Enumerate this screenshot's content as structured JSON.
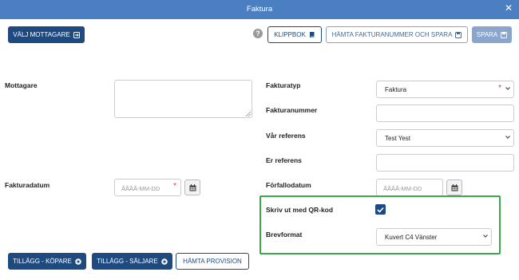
{
  "window": {
    "title": "Faktura"
  },
  "toolbar": {
    "select_recipient": "VÄLJ MOTTAGARE",
    "clipboard": "KLIPPBOK",
    "fetch_and_save": "HÄMTA FAKTURANUMMER OCH SPARA",
    "save": "SPARA"
  },
  "form": {
    "recipient_label": "Mottagare",
    "invoice_date_label": "Fakturadatum",
    "invoice_date_placeholder": "ÅÅÅÅ-MM-DD",
    "invoice_type_label": "Fakturatyp",
    "invoice_type_value": "Faktura",
    "invoice_number_label": "Fakturanummer",
    "our_reference_label": "Vår referens",
    "our_reference_value": "Test Yest",
    "your_reference_label": "Er referens",
    "due_date_label": "Förfallodatum",
    "due_date_placeholder": "ÅÅÅÅ-MM-DD",
    "qr_label": "Skriv ut med QR-kod",
    "qr_checked": true,
    "letter_format_label": "Brevformat",
    "letter_format_value": "Kuvert C4 Vänster",
    "required_mark": "*"
  },
  "bottom_buttons": {
    "addon_buyer": "TILLÄGG - KÖPARE",
    "addon_seller": "TILLÄGG - SÄLJARE",
    "fetch_commission": "HÄMTA PROVISION"
  },
  "colors": {
    "header": "#4a7fc1",
    "primary": "#1e4a80",
    "disabled": "#8aa6cc",
    "highlight": "#3aa84b",
    "required": "#e0314b"
  }
}
